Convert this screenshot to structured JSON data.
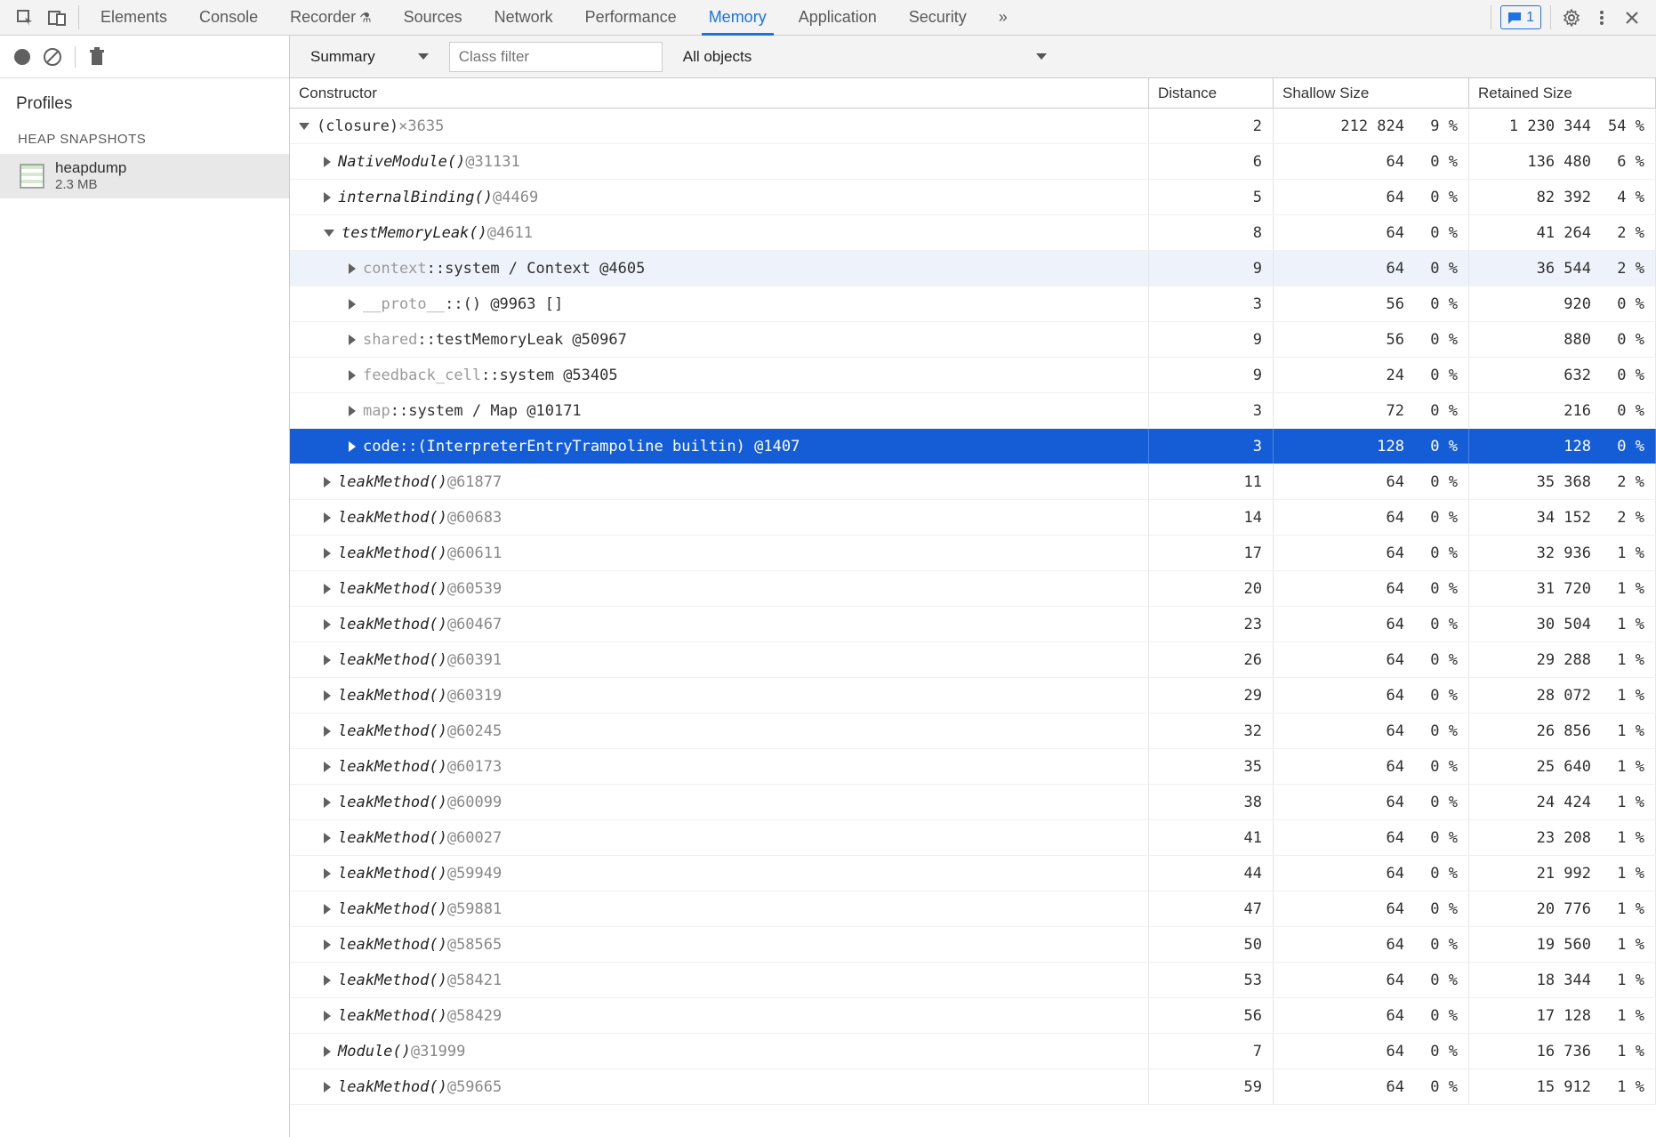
{
  "tabs": {
    "items": [
      "Elements",
      "Console",
      "Recorder",
      "Sources",
      "Network",
      "Performance",
      "Memory",
      "Application",
      "Security"
    ],
    "active": "Memory",
    "recorderBeaker": true,
    "msgCount": "1"
  },
  "sidebar": {
    "profilesLabel": "Profiles",
    "heapHeader": "HEAP SNAPSHOTS",
    "snapshot": {
      "name": "heapdump",
      "size": "2.3 MB"
    }
  },
  "toolbar": {
    "summaryLabel": "Summary",
    "classFilterPlaceholder": "Class filter",
    "scopeLabel": "All objects"
  },
  "columns": {
    "constructor": "Constructor",
    "distance": "Distance",
    "shallow": "Shallow Size",
    "retained": "Retained Size"
  },
  "rows": [
    {
      "indent": 0,
      "expand": "open",
      "label": "(closure)",
      "suffix": " ×3635",
      "italic": false,
      "prop": false,
      "distance": "2",
      "sv": "212 824",
      "sp": "9 %",
      "rv": "1 230 344",
      "rp": "54 %",
      "state": ""
    },
    {
      "indent": 1,
      "expand": "closed",
      "label": "NativeModule()",
      "suffix": " @31131",
      "italic": true,
      "distance": "6",
      "sv": "64",
      "sp": "0 %",
      "rv": "136 480",
      "rp": "6 %",
      "state": ""
    },
    {
      "indent": 1,
      "expand": "closed",
      "label": "internalBinding()",
      "suffix": " @4469",
      "italic": true,
      "distance": "5",
      "sv": "64",
      "sp": "0 %",
      "rv": "82 392",
      "rp": "4 %",
      "state": ""
    },
    {
      "indent": 1,
      "expand": "open",
      "label": "testMemoryLeak()",
      "suffix": " @4611",
      "italic": true,
      "distance": "8",
      "sv": "64",
      "sp": "0 %",
      "rv": "41 264",
      "rp": "2 %",
      "state": ""
    },
    {
      "indent": 2,
      "expand": "closed",
      "prop": true,
      "propName": "context",
      "sep": " :: ",
      "label": "system / Context @4605",
      "distance": "9",
      "sv": "64",
      "sp": "0 %",
      "rv": "36 544",
      "rp": "2 %",
      "state": "highlight"
    },
    {
      "indent": 2,
      "expand": "closed",
      "prop": true,
      "propName": "__proto__",
      "sep": " :: ",
      "label": "() @9963 []",
      "distance": "3",
      "sv": "56",
      "sp": "0 %",
      "rv": "920",
      "rp": "0 %",
      "state": ""
    },
    {
      "indent": 2,
      "expand": "closed",
      "prop": true,
      "propName": "shared",
      "sep": " :: ",
      "label": "testMemoryLeak @50967",
      "distance": "9",
      "sv": "56",
      "sp": "0 %",
      "rv": "880",
      "rp": "0 %",
      "state": ""
    },
    {
      "indent": 2,
      "expand": "closed",
      "prop": true,
      "propName": "feedback_cell",
      "sep": " :: ",
      "label": "system @53405",
      "distance": "9",
      "sv": "24",
      "sp": "0 %",
      "rv": "632",
      "rp": "0 %",
      "state": ""
    },
    {
      "indent": 2,
      "expand": "closed",
      "prop": true,
      "propName": "map",
      "sep": " :: ",
      "label": "system / Map @10171",
      "distance": "3",
      "sv": "72",
      "sp": "0 %",
      "rv": "216",
      "rp": "0 %",
      "state": ""
    },
    {
      "indent": 2,
      "expand": "closed",
      "prop": true,
      "propName": "code",
      "sep": " :: ",
      "label": "(InterpreterEntryTrampoline builtin) @1407",
      "distance": "3",
      "sv": "128",
      "sp": "0 %",
      "rv": "128",
      "rp": "0 %",
      "state": "selected"
    },
    {
      "indent": 1,
      "expand": "closed",
      "label": "leakMethod()",
      "suffix": " @61877",
      "italic": true,
      "distance": "11",
      "sv": "64",
      "sp": "0 %",
      "rv": "35 368",
      "rp": "2 %",
      "state": ""
    },
    {
      "indent": 1,
      "expand": "closed",
      "label": "leakMethod()",
      "suffix": " @60683",
      "italic": true,
      "distance": "14",
      "sv": "64",
      "sp": "0 %",
      "rv": "34 152",
      "rp": "2 %",
      "state": ""
    },
    {
      "indent": 1,
      "expand": "closed",
      "label": "leakMethod()",
      "suffix": " @60611",
      "italic": true,
      "distance": "17",
      "sv": "64",
      "sp": "0 %",
      "rv": "32 936",
      "rp": "1 %",
      "state": ""
    },
    {
      "indent": 1,
      "expand": "closed",
      "label": "leakMethod()",
      "suffix": " @60539",
      "italic": true,
      "distance": "20",
      "sv": "64",
      "sp": "0 %",
      "rv": "31 720",
      "rp": "1 %",
      "state": ""
    },
    {
      "indent": 1,
      "expand": "closed",
      "label": "leakMethod()",
      "suffix": " @60467",
      "italic": true,
      "distance": "23",
      "sv": "64",
      "sp": "0 %",
      "rv": "30 504",
      "rp": "1 %",
      "state": ""
    },
    {
      "indent": 1,
      "expand": "closed",
      "label": "leakMethod()",
      "suffix": " @60391",
      "italic": true,
      "distance": "26",
      "sv": "64",
      "sp": "0 %",
      "rv": "29 288",
      "rp": "1 %",
      "state": ""
    },
    {
      "indent": 1,
      "expand": "closed",
      "label": "leakMethod()",
      "suffix": " @60319",
      "italic": true,
      "distance": "29",
      "sv": "64",
      "sp": "0 %",
      "rv": "28 072",
      "rp": "1 %",
      "state": ""
    },
    {
      "indent": 1,
      "expand": "closed",
      "label": "leakMethod()",
      "suffix": " @60245",
      "italic": true,
      "distance": "32",
      "sv": "64",
      "sp": "0 %",
      "rv": "26 856",
      "rp": "1 %",
      "state": ""
    },
    {
      "indent": 1,
      "expand": "closed",
      "label": "leakMethod()",
      "suffix": " @60173",
      "italic": true,
      "distance": "35",
      "sv": "64",
      "sp": "0 %",
      "rv": "25 640",
      "rp": "1 %",
      "state": ""
    },
    {
      "indent": 1,
      "expand": "closed",
      "label": "leakMethod()",
      "suffix": " @60099",
      "italic": true,
      "distance": "38",
      "sv": "64",
      "sp": "0 %",
      "rv": "24 424",
      "rp": "1 %",
      "state": ""
    },
    {
      "indent": 1,
      "expand": "closed",
      "label": "leakMethod()",
      "suffix": " @60027",
      "italic": true,
      "distance": "41",
      "sv": "64",
      "sp": "0 %",
      "rv": "23 208",
      "rp": "1 %",
      "state": ""
    },
    {
      "indent": 1,
      "expand": "closed",
      "label": "leakMethod()",
      "suffix": " @59949",
      "italic": true,
      "distance": "44",
      "sv": "64",
      "sp": "0 %",
      "rv": "21 992",
      "rp": "1 %",
      "state": ""
    },
    {
      "indent": 1,
      "expand": "closed",
      "label": "leakMethod()",
      "suffix": " @59881",
      "italic": true,
      "distance": "47",
      "sv": "64",
      "sp": "0 %",
      "rv": "20 776",
      "rp": "1 %",
      "state": ""
    },
    {
      "indent": 1,
      "expand": "closed",
      "label": "leakMethod()",
      "suffix": " @58565",
      "italic": true,
      "distance": "50",
      "sv": "64",
      "sp": "0 %",
      "rv": "19 560",
      "rp": "1 %",
      "state": ""
    },
    {
      "indent": 1,
      "expand": "closed",
      "label": "leakMethod()",
      "suffix": " @58421",
      "italic": true,
      "distance": "53",
      "sv": "64",
      "sp": "0 %",
      "rv": "18 344",
      "rp": "1 %",
      "state": ""
    },
    {
      "indent": 1,
      "expand": "closed",
      "label": "leakMethod()",
      "suffix": " @58429",
      "italic": true,
      "distance": "56",
      "sv": "64",
      "sp": "0 %",
      "rv": "17 128",
      "rp": "1 %",
      "state": ""
    },
    {
      "indent": 1,
      "expand": "closed",
      "label": "Module()",
      "suffix": " @31999",
      "italic": true,
      "distance": "7",
      "sv": "64",
      "sp": "0 %",
      "rv": "16 736",
      "rp": "1 %",
      "state": ""
    },
    {
      "indent": 1,
      "expand": "closed",
      "label": "leakMethod()",
      "suffix": " @59665",
      "italic": true,
      "distance": "59",
      "sv": "64",
      "sp": "0 %",
      "rv": "15 912",
      "rp": "1 %",
      "state": ""
    }
  ]
}
